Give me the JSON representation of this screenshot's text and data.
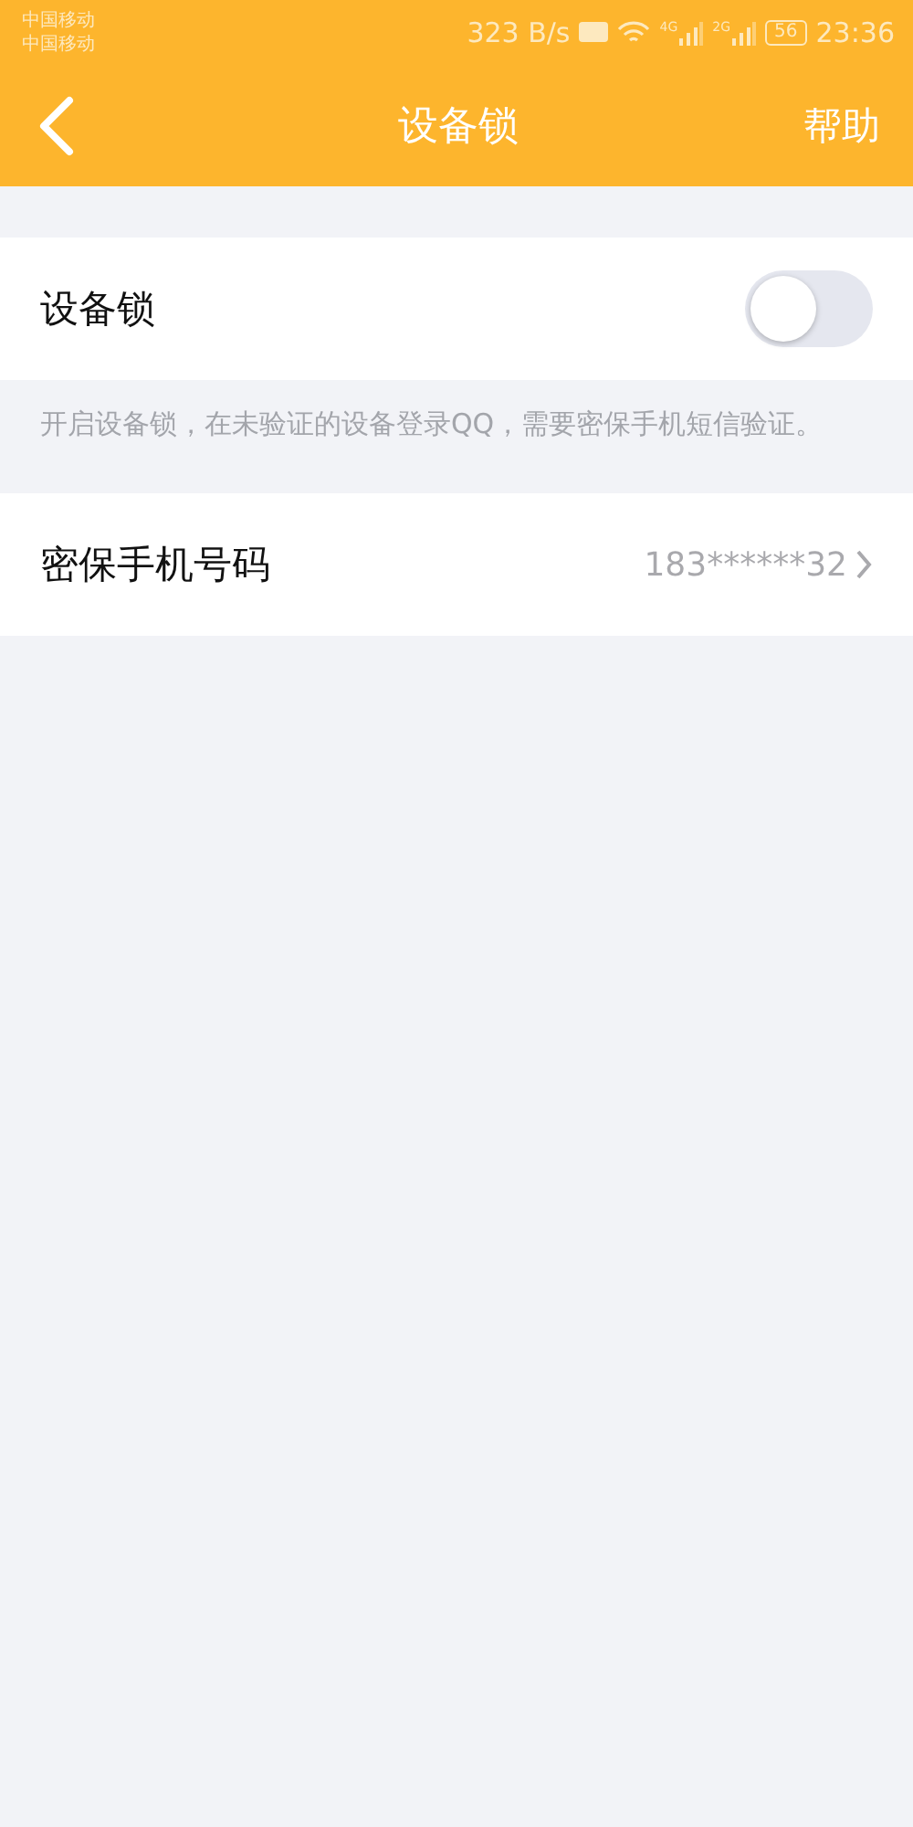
{
  "status_bar": {
    "carriers": [
      "中国移动",
      "中国移动"
    ],
    "speed": "323 B/s",
    "signal_labels": [
      "4G",
      "2G"
    ],
    "battery": "56",
    "time": "23:36"
  },
  "nav": {
    "title": "设备锁",
    "action": "帮助"
  },
  "toggle_row": {
    "label": "设备锁",
    "on": false
  },
  "description": "开启设备锁，在未验证的设备登录QQ，需要密保手机短信验证。",
  "phone_row": {
    "label": "密保手机号码",
    "value": "183******32"
  }
}
